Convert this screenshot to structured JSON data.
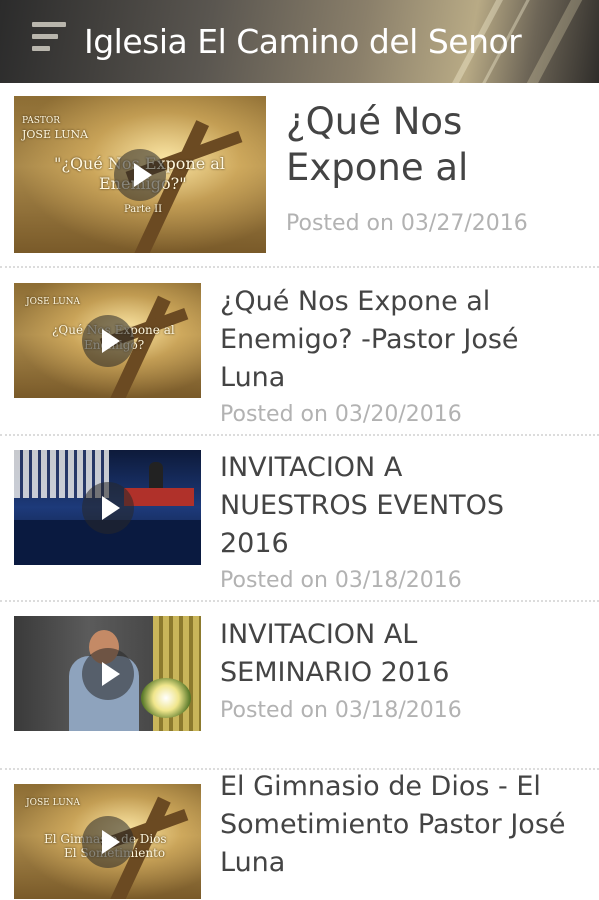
{
  "header": {
    "title": "Iglesia El Camino del Senor",
    "menu_icon": "hamburger-menu-icon"
  },
  "items": [
    {
      "title_lines": [
        "¿Qué Nos",
        "Expone al"
      ],
      "date": "Posted on 03/27/2016",
      "thumb": {
        "style": "gold",
        "lines": [
          "PASTOR",
          "JOSE LUNA",
          "\"¿Qué Nos Expone al",
          "Enemigo?\"",
          "Parte II"
        ]
      }
    },
    {
      "title_lines": [
        "¿Qué Nos Expone al",
        "Enemigo? -Pastor José",
        "Luna"
      ],
      "date": "Posted on 03/20/2016",
      "thumb": {
        "style": "gold",
        "lines": [
          "JOSE LUNA",
          "¿Qué Nos Expone al",
          "Enemigo?"
        ]
      }
    },
    {
      "title_lines": [
        "INVITACION A",
        "NUESTROS EVENTOS",
        "2016"
      ],
      "date": "Posted on 03/18/2016",
      "thumb": {
        "style": "stage"
      }
    },
    {
      "title_lines": [
        "INVITACION AL",
        "SEMINARIO 2016"
      ],
      "date": "Posted on 03/18/2016",
      "thumb": {
        "style": "preacher"
      }
    },
    {
      "title_lines": [
        "El Gimnasio de Dios - El",
        "Sometimiento Pastor José",
        "Luna"
      ],
      "date": "",
      "thumb": {
        "style": "gold",
        "lines": [
          "JOSE LUNA",
          "El Gimnasio de Dios",
          "El Sometimiento"
        ]
      }
    }
  ]
}
